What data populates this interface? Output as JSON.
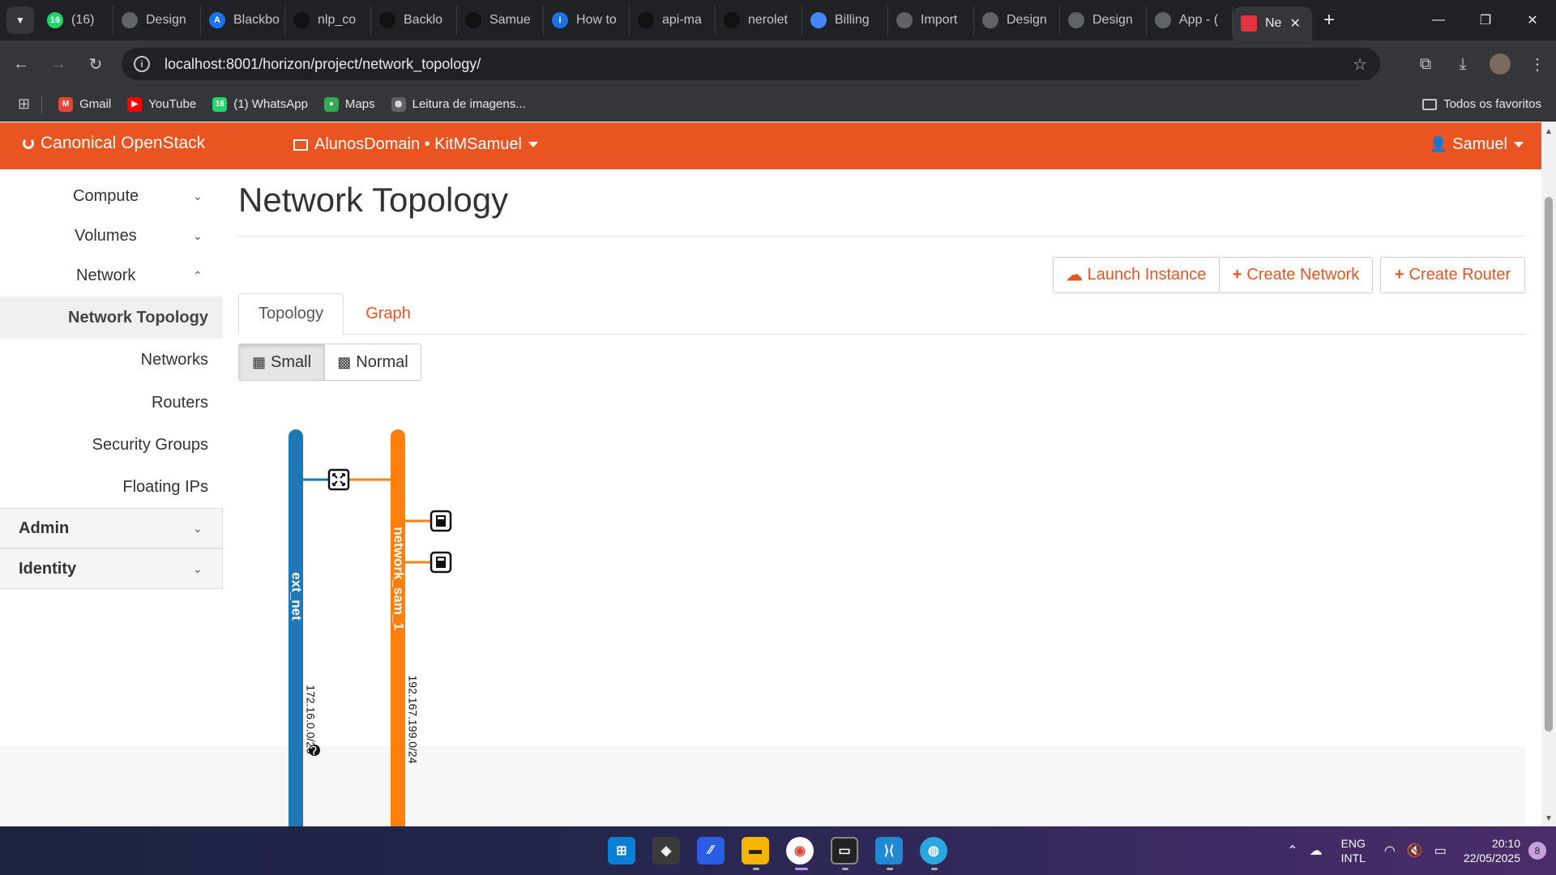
{
  "browser": {
    "tabs": [
      {
        "label": "(16)",
        "favicon": "whatsapp-icon",
        "color": "#25d366",
        "badge": "16"
      },
      {
        "label": "Design",
        "favicon": "globe-icon",
        "color": "#5f6368"
      },
      {
        "label": "Blackbo",
        "favicon": "blackbox-icon",
        "color": "#1a73e8",
        "badge": "A"
      },
      {
        "label": "nlp_co",
        "favicon": "github-icon",
        "color": "#111111"
      },
      {
        "label": "Backlo",
        "favicon": "github-icon",
        "color": "#111111"
      },
      {
        "label": "Samue",
        "favicon": "github-icon",
        "color": "#111111"
      },
      {
        "label": "How to",
        "favicon": "info-icon",
        "color": "#1a73e8",
        "badge": "i"
      },
      {
        "label": "api-ma",
        "favicon": "github-icon",
        "color": "#111111"
      },
      {
        "label": "nerolet",
        "favicon": "github-icon",
        "color": "#111111"
      },
      {
        "label": "Billing",
        "favicon": "billing-icon",
        "color": "#4285f4"
      },
      {
        "label": "Import",
        "favicon": "openai-icon",
        "color": "#5f6368"
      },
      {
        "label": "Design",
        "favicon": "globe-icon",
        "color": "#5f6368"
      },
      {
        "label": "Design",
        "favicon": "globe-icon",
        "color": "#5f6368"
      },
      {
        "label": "App - (",
        "favicon": "app-icon",
        "color": "#5f6368"
      },
      {
        "label": "Ne",
        "favicon": "openstack-icon",
        "color": "#e5323e",
        "active": true
      }
    ],
    "url": "localhost:8001/horizon/project/network_topology/",
    "bookmarks": [
      {
        "label": "Gmail",
        "icon": "gmail-icon",
        "color": "#ea4335",
        "glyph": "M"
      },
      {
        "label": "YouTube",
        "icon": "youtube-icon",
        "color": "#ff0000",
        "glyph": "▶"
      },
      {
        "label": "(1) WhatsApp",
        "icon": "whatsapp-icon",
        "color": "#25d366",
        "glyph": "16"
      },
      {
        "label": "Maps",
        "icon": "maps-icon",
        "color": "#34a853",
        "glyph": "●"
      },
      {
        "label": "Leitura de imagens...",
        "icon": "globe-icon",
        "color": "#5f6368",
        "glyph": "◍"
      }
    ],
    "all_bookmarks": "Todos os favoritos"
  },
  "header": {
    "brand": "Canonical OpenStack",
    "project": "AlunosDomain • KitMSamuel",
    "user": "Samuel",
    "accent": "#e95420"
  },
  "sidebar": {
    "compute": "Compute",
    "volumes": "Volumes",
    "network": "Network",
    "items": [
      "Network Topology",
      "Networks",
      "Routers",
      "Security Groups",
      "Floating IPs"
    ],
    "admin": "Admin",
    "identity": "Identity"
  },
  "main": {
    "title": "Network Topology",
    "actions": {
      "launch": "Launch Instance",
      "create_network": "Create Network",
      "create_router": "Create Router"
    },
    "tabs": {
      "topology": "Topology",
      "graph": "Graph"
    },
    "size": {
      "small": "Small",
      "normal": "Normal"
    }
  },
  "topology": {
    "networks": [
      {
        "name": "ext_net",
        "cidr": "172.16.0.0/20",
        "color": "#1f77b4",
        "external": true
      },
      {
        "name": "network_sam_1",
        "cidr": "192.167.199.0/24",
        "color": "#ff7f0e"
      }
    ],
    "router": {
      "icon": "router-icon"
    },
    "instances": [
      {
        "icon": "instance-icon"
      },
      {
        "icon": "instance-icon"
      }
    ]
  },
  "taskbar": {
    "lang": "ENG",
    "layout": "INTL",
    "time": "20:10",
    "date": "22/05/2025",
    "notifications": "8"
  }
}
